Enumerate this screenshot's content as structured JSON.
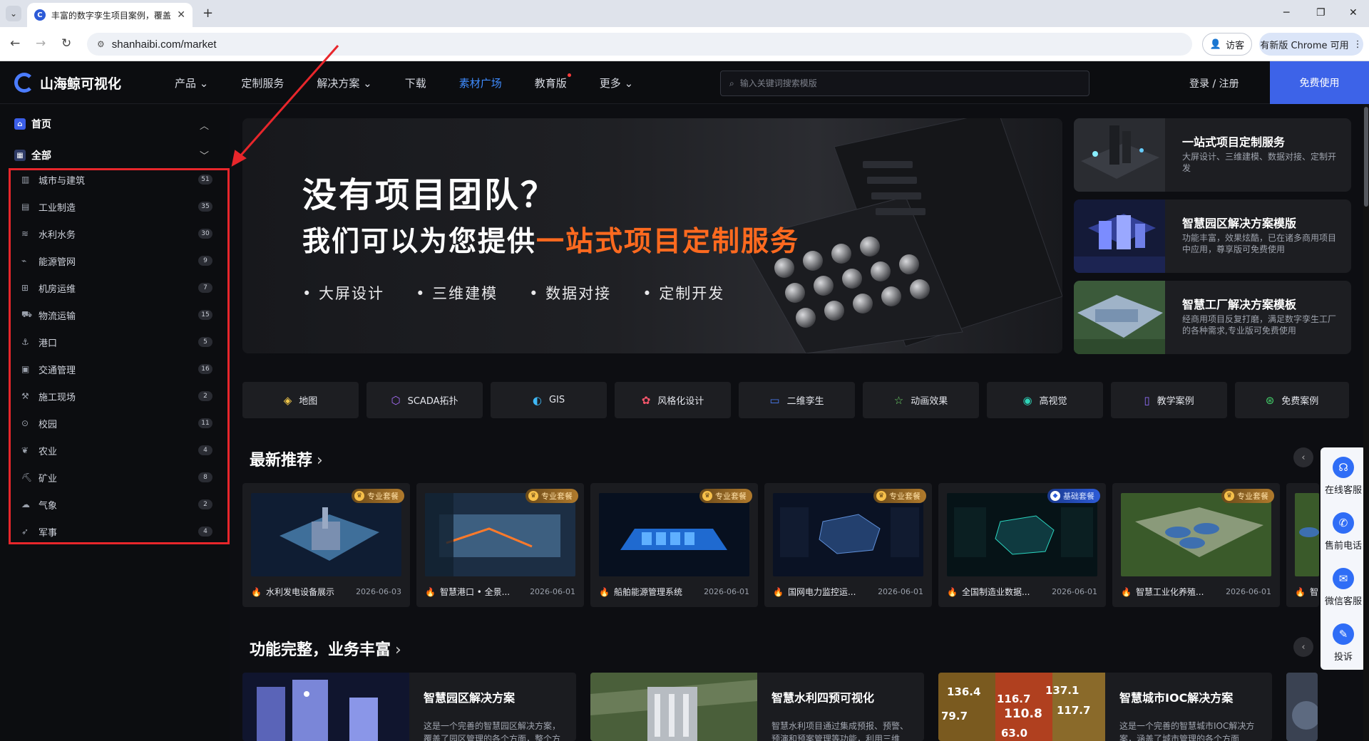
{
  "browser": {
    "tab_title": "丰富的数字孪生项目案例，覆盖",
    "url": "shanhaibi.com/market",
    "guest_label": "访客",
    "update_label": "有新版 Chrome 可用"
  },
  "header": {
    "logo_text": "山海鲸可视化",
    "nav": [
      "产品",
      "定制服务",
      "解决方案",
      "下载",
      "素材广场",
      "教育版",
      "更多"
    ],
    "search_placeholder": "输入关键词搜索模版",
    "login": "登录 / 注册",
    "free_use": "免费使用"
  },
  "sidebar": {
    "home": "首页",
    "all": "全部",
    "categories": [
      {
        "label": "城市与建筑",
        "count": "51"
      },
      {
        "label": "工业制造",
        "count": "35"
      },
      {
        "label": "水利水务",
        "count": "30"
      },
      {
        "label": "能源管网",
        "count": "9"
      },
      {
        "label": "机房运维",
        "count": "7"
      },
      {
        "label": "物流运输",
        "count": "15"
      },
      {
        "label": "港口",
        "count": "5"
      },
      {
        "label": "交通管理",
        "count": "16"
      },
      {
        "label": "施工现场",
        "count": "2"
      },
      {
        "label": "校园",
        "count": "11"
      },
      {
        "label": "农业",
        "count": "4"
      },
      {
        "label": "矿业",
        "count": "8"
      },
      {
        "label": "气象",
        "count": "2"
      },
      {
        "label": "军事",
        "count": "4"
      }
    ]
  },
  "hero": {
    "title1": "没有项目团队？",
    "title2_pre": "我们可以为您提供",
    "title2_hl": "一站式项目定制服务",
    "bullets": [
      "• 大屏设计",
      "• 三维建模",
      "• 数据对接",
      "• 定制开发"
    ]
  },
  "promos": [
    {
      "title": "一站式项目定制服务",
      "desc": "大屏设计、三维建模、数据对接、定制开发"
    },
    {
      "title": "智慧园区解决方案模版",
      "desc": "功能丰富，效果炫酷，已在诸多商用项目中应用，尊享版可免费使用"
    },
    {
      "title": "智慧工厂解决方案模板",
      "desc": "经商用项目反复打磨，满足数字孪生工厂的各种需求,专业版可免费使用"
    }
  ],
  "chips": [
    "地图",
    "SCADA拓扑",
    "GIS",
    "风格化设计",
    "二维孪生",
    "动画效果",
    "高视觉",
    "教学案例",
    "免费案例"
  ],
  "latest": {
    "title": "最新推荐",
    "cards": [
      {
        "title": "水利发电设备展示",
        "date": "2026-06-03",
        "badge": "专业套餐"
      },
      {
        "title": "智慧港口 • 全景...",
        "date": "2026-06-01",
        "badge": "专业套餐"
      },
      {
        "title": "船舶能源管理系统",
        "date": "2026-06-01",
        "badge": "专业套餐"
      },
      {
        "title": "国网电力监控运...",
        "date": "2026-06-01",
        "badge": "专业套餐"
      },
      {
        "title": "全国制造业数据...",
        "date": "2026-06-01",
        "badge": "基础套餐"
      },
      {
        "title": "智慧工业化养殖...",
        "date": "2026-06-01",
        "badge": "专业套餐"
      },
      {
        "title": "智",
        "date": "",
        "badge": ""
      }
    ]
  },
  "solutions": {
    "title": "功能完整，业务丰富",
    "cards": [
      {
        "title": "智慧园区解决方案",
        "desc": "这是一个完善的智慧园区解决方案，覆盖了园区管理的各个方面，整个方"
      },
      {
        "title": "智慧水利四预可视化",
        "desc": "智慧水利项目通过集成预报、预警、预演和预案管理等功能，利用三维"
      },
      {
        "title": "智慧城市IOC解决方案",
        "desc": "这是一个完善的智慧城市IOC解决方案，涵盖了城市管理的各个方面"
      }
    ],
    "heat_values": [
      "136.4",
      "116.7",
      "137.1",
      "79.7",
      "110.8",
      "117.7",
      "63.0"
    ]
  },
  "float_bar": [
    "在线客服",
    "售前电话",
    "微信客服",
    "投诉"
  ],
  "colors": {
    "accent": "#3d63e8",
    "highlight": "#ff6a1f",
    "annotation": "#e8262b",
    "active_nav": "#3f8cff"
  }
}
